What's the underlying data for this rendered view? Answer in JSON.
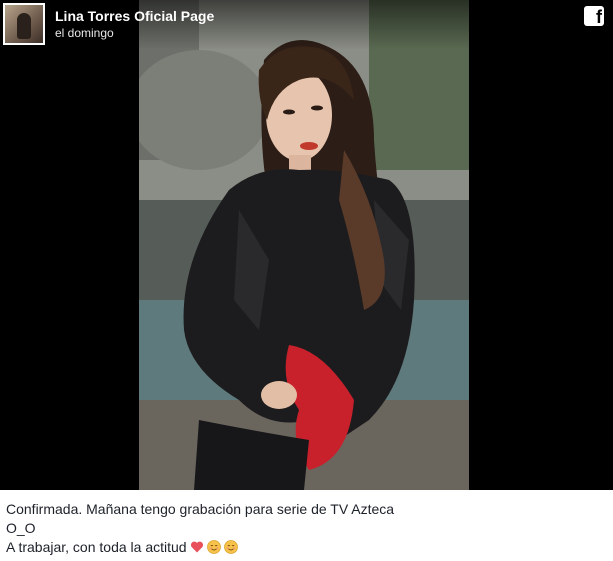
{
  "post": {
    "page_name": "Lina Torres Oficial Page",
    "time": "el domingo",
    "platform_icon": "facebook-icon",
    "caption_lines": [
      "Confirmada. Mañana tengo grabación para serie de TV Azteca",
      "O_O",
      "A trabajar, con toda la actitud"
    ],
    "caption_emojis": [
      "heart-emoji",
      "blush-emoji",
      "blush-emoji"
    ]
  },
  "colors": {
    "background": "#000000",
    "caption_text": "#1d2129",
    "header_text": "#ffffff",
    "heart": "#e8505b",
    "emoji_face": "#f7c24a"
  }
}
